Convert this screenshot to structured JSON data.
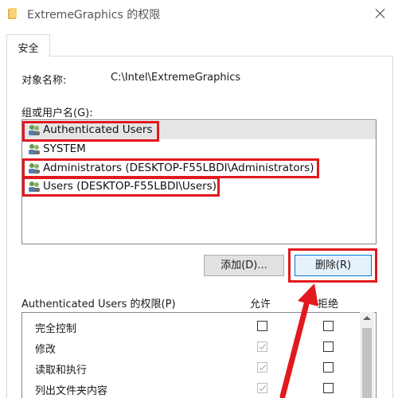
{
  "window": {
    "title": "ExtremeGraphics 的权限"
  },
  "tabs": [
    {
      "label": "安全",
      "selected": true
    }
  ],
  "object_name": {
    "label": "对象名称:",
    "value": "C:\\Intel\\ExtremeGraphics"
  },
  "groups": {
    "label": "组或用户名(G):",
    "items": [
      {
        "name": "Authenticated Users",
        "selected": true,
        "highlighted": true
      },
      {
        "name": "SYSTEM",
        "selected": false,
        "highlighted": false
      },
      {
        "name": "Administrators (DESKTOP-F55LBDI\\Administrators)",
        "selected": false,
        "highlighted": true
      },
      {
        "name": "Users (DESKTOP-F55LBDI\\Users)",
        "selected": false,
        "highlighted": true
      }
    ]
  },
  "buttons": {
    "add": "添加(D)...",
    "remove": "删除(R)"
  },
  "permissions": {
    "label": "Authenticated Users 的权限(P)",
    "allow_header": "允许",
    "deny_header": "拒绝",
    "items": [
      {
        "name": "完全控制",
        "allow": false,
        "allow_disabled": false,
        "deny": false
      },
      {
        "name": "修改",
        "allow": true,
        "allow_disabled": true,
        "deny": false
      },
      {
        "name": "读取和执行",
        "allow": true,
        "allow_disabled": true,
        "deny": false
      },
      {
        "name": "列出文件夹内容",
        "allow": true,
        "allow_disabled": true,
        "deny": false
      }
    ]
  },
  "colors": {
    "highlight_box": "#e2191e",
    "focus_border": "#0078d7",
    "selected_row": "#e5e5e5"
  }
}
